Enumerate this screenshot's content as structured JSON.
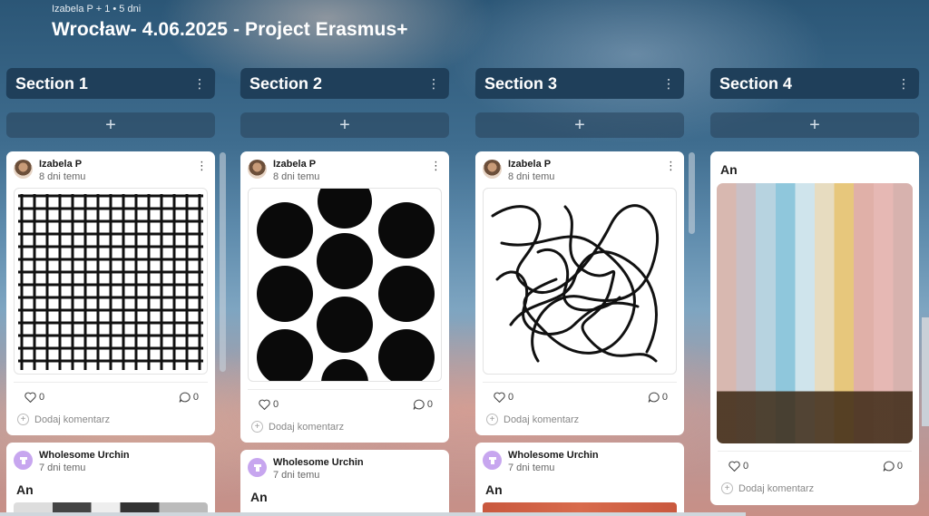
{
  "board": {
    "meta": "Izabela P + 1 • 5 dni",
    "title": "Wrocław- 4.06.2025 - Project Erasmus+"
  },
  "sections": [
    {
      "title": "Section 1"
    },
    {
      "title": "Section 2"
    },
    {
      "title": "Section 3"
    },
    {
      "title": "Section 4"
    }
  ],
  "icons": {
    "add": "+",
    "kebab": "⋮",
    "heart": "heart-icon",
    "comment": "comment-icon"
  },
  "cards": {
    "s1_c1": {
      "author": "Izabela P",
      "ago": "8 dni temu",
      "likes": "0",
      "comments": "0",
      "add_comment": "Dodaj komentarz"
    },
    "s1_c2": {
      "author": "Wholesome Urchin",
      "ago": "7 dni temu",
      "text": "An"
    },
    "s2_c1": {
      "author": "Izabela P",
      "ago": "8 dni temu",
      "likes": "0",
      "comments": "0",
      "add_comment": "Dodaj komentarz"
    },
    "s2_c2": {
      "author": "Wholesome Urchin",
      "ago": "7 dni temu",
      "text": "An"
    },
    "s3_c1": {
      "author": "Izabela P",
      "ago": "8 dni temu",
      "likes": "0",
      "comments": "0",
      "add_comment": "Dodaj komentarz"
    },
    "s3_c2": {
      "author": "Wholesome Urchin",
      "ago": "7 dni temu",
      "text": "An"
    },
    "s4_c1": {
      "text": "An",
      "likes": "0",
      "comments": "0",
      "add_comment": "Dodaj komentarz"
    }
  }
}
